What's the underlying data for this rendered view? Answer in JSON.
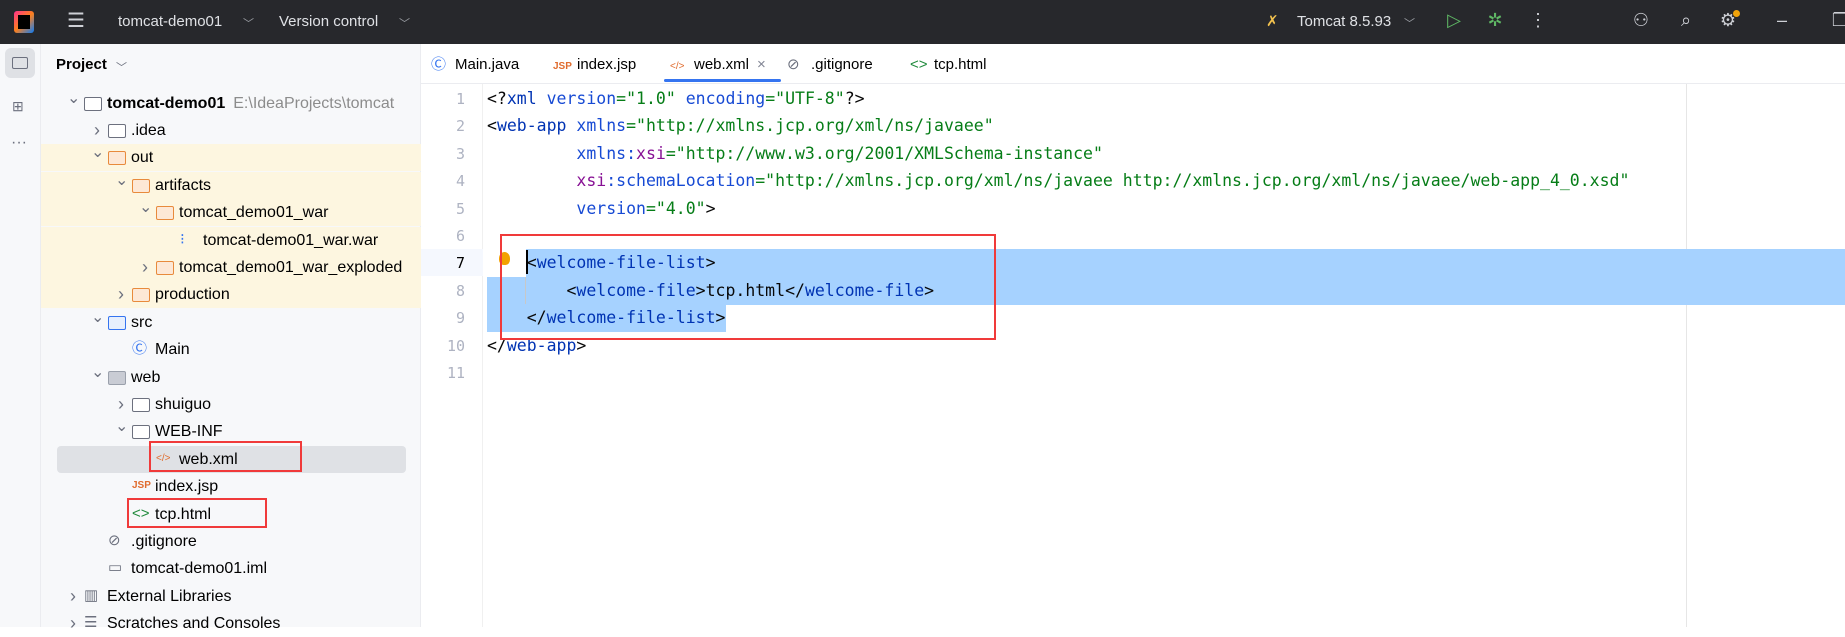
{
  "titlebar": {
    "project": "tomcat-demo01",
    "vcs": "Version control",
    "run_config": "Tomcat 8.5.93"
  },
  "colors": {
    "accent": "#3574f0",
    "selection": "#a6d2ff",
    "highlight_red": "#f03a3a",
    "excluded_bg": "#fdf6e0"
  },
  "project_panel": {
    "title": "Project",
    "items": [
      {
        "label": "tomcat-demo01",
        "hint": "E:\\IdeaProjects\\tomcat",
        "level": 0,
        "chevron": "down",
        "icon": "module-folder",
        "bold": true
      },
      {
        "label": ".idea",
        "level": 1,
        "chevron": "right",
        "icon": "folder"
      },
      {
        "label": "out",
        "level": 1,
        "chevron": "down",
        "icon": "folder-orange",
        "excluded": true
      },
      {
        "label": "artifacts",
        "level": 2,
        "chevron": "down",
        "icon": "folder-orange",
        "excluded": true
      },
      {
        "label": "tomcat_demo01_war",
        "level": 3,
        "chevron": "down",
        "icon": "folder-orange",
        "excluded": true
      },
      {
        "label": "tomcat-demo01_war.war",
        "level": 4,
        "icon": "archive",
        "excluded": true
      },
      {
        "label": "tomcat_demo01_war_exploded",
        "level": 3,
        "chevron": "right",
        "icon": "folder-orange",
        "excluded": true
      },
      {
        "label": "production",
        "level": 2,
        "chevron": "right",
        "icon": "folder-orange",
        "excluded": true
      },
      {
        "label": "src",
        "level": 1,
        "chevron": "down",
        "icon": "folder-blue"
      },
      {
        "label": "Main",
        "level": 2,
        "icon": "class"
      },
      {
        "label": "web",
        "level": 1,
        "chevron": "down",
        "icon": "web-folder"
      },
      {
        "label": "shuiguo",
        "level": 2,
        "chevron": "right",
        "icon": "folder"
      },
      {
        "label": "WEB-INF",
        "level": 2,
        "chevron": "down",
        "icon": "folder"
      },
      {
        "label": "web.xml",
        "level": 3,
        "icon": "xml",
        "selected": true
      },
      {
        "label": "index.jsp",
        "level": 2,
        "icon": "jsp"
      },
      {
        "label": "tcp.html",
        "level": 2,
        "icon": "html"
      },
      {
        "label": ".gitignore",
        "level": 1,
        "icon": "ignore"
      },
      {
        "label": "tomcat-demo01.iml",
        "level": 1,
        "icon": "iml"
      },
      {
        "label": "External Libraries",
        "level": 0,
        "chevron": "right",
        "icon": "library"
      },
      {
        "label": "Scratches and Consoles",
        "level": 0,
        "chevron": "right",
        "icon": "scratches"
      }
    ]
  },
  "tabs": [
    {
      "label": "Main.java",
      "icon": "class"
    },
    {
      "label": "index.jsp",
      "icon": "jsp"
    },
    {
      "label": "web.xml",
      "icon": "xml",
      "active": true,
      "closable": true
    },
    {
      "label": ".gitignore",
      "icon": "ignore"
    },
    {
      "label": "tcp.html",
      "icon": "html"
    }
  ],
  "editor": {
    "caret_line": 7,
    "lines": [
      [
        [
          "<?",
          "br"
        ],
        [
          "xml ",
          "tag"
        ],
        [
          "version",
          "attr"
        ],
        [
          "=\"1.0\" ",
          "val"
        ],
        [
          "encoding",
          "attr"
        ],
        [
          "=\"UTF-8\"",
          "val"
        ],
        [
          "?>",
          "br"
        ]
      ],
      [
        [
          "<",
          "br"
        ],
        [
          "web-app ",
          "tag"
        ],
        [
          "xmlns",
          "attr"
        ],
        [
          "=\"http://xmlns.jcp.org/xml/ns/javaee\"",
          "val"
        ]
      ],
      [
        [
          "         ",
          "txt"
        ],
        [
          "xmlns:",
          "attr"
        ],
        [
          "xsi",
          "ns"
        ],
        [
          "=\"http://www.w3.org/2001/XMLSchema-instance\"",
          "val"
        ]
      ],
      [
        [
          "         ",
          "txt"
        ],
        [
          "xsi",
          "ns"
        ],
        [
          ":schemaLocation",
          "attr"
        ],
        [
          "=\"http://xmlns.jcp.org/xml/ns/javaee http://xmlns.jcp.org/xml/ns/javaee/web-app_4_0.xsd\"",
          "val"
        ]
      ],
      [
        [
          "         ",
          "txt"
        ],
        [
          "version",
          "attr"
        ],
        [
          "=\"4.0\"",
          "val"
        ],
        [
          ">",
          "br"
        ]
      ],
      [],
      [
        [
          "    ",
          "txt"
        ],
        [
          "<",
          "br"
        ],
        [
          "welcome-file-list",
          "tag"
        ],
        [
          ">",
          "br"
        ]
      ],
      [
        [
          "        ",
          "txt"
        ],
        [
          "<",
          "br"
        ],
        [
          "welcome-file",
          "tag"
        ],
        [
          ">",
          "br"
        ],
        [
          "tcp.html",
          "txt"
        ],
        [
          "</",
          "br"
        ],
        [
          "welcome-file",
          "tag"
        ],
        [
          ">",
          "br"
        ]
      ],
      [
        [
          "    ",
          "txt"
        ],
        [
          "</",
          "br"
        ],
        [
          "welcome-file-list",
          "tag"
        ],
        [
          ">",
          "br"
        ]
      ],
      [
        [
          "</",
          "br"
        ],
        [
          "web-app",
          "tag"
        ],
        [
          ">",
          "br"
        ]
      ],
      []
    ]
  }
}
